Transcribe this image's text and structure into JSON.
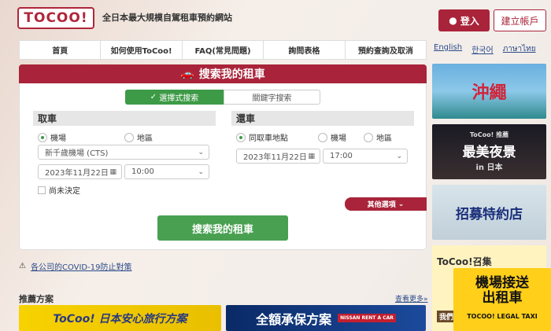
{
  "header": {
    "logo": "TOCOO!",
    "tagline": "全日本最大規模自駕租車預約網站",
    "login": "登入",
    "register": "建立帳戶"
  },
  "nav": [
    "首頁",
    "如何使用ToCoo!",
    "FAQ(常見問題)",
    "詢問表格",
    "預約查詢及取消"
  ],
  "langs": [
    "English",
    "한국어",
    "ภาษาไทย"
  ],
  "search": {
    "title": "搜索我的租車",
    "tab_select": "選擇式搜索",
    "tab_keyword": "關鍵字搜索",
    "pickup": {
      "heading": "取車",
      "opt_airport": "機場",
      "opt_area": "地區",
      "location": "新千歲機場 (CTS)",
      "date": "2023年11月22日",
      "time": "10:00",
      "undecided": "尚未決定"
    },
    "return": {
      "heading": "還車",
      "opt_same": "同取車地點",
      "opt_airport": "機場",
      "opt_area": "地區",
      "date": "2023年11月22日",
      "time": "17:00"
    },
    "other_options": "其他選項",
    "submit": "搜索我的租車"
  },
  "covid": "各公司的COVID-19防止對策",
  "recommend": {
    "title": "推薦方案",
    "see_more": "查看更多»",
    "items": [
      "ToCoo! 日本安心旅行方案",
      "全額承保方案"
    ],
    "brand_badge": "NISSAN RENT A CAR"
  },
  "side_banners": {
    "okinawa": "沖繩",
    "nightview_small": "ToCoo! 推薦",
    "nightview": "最美夜景",
    "nightview_sub": "in 日本",
    "recruit": "招募特約店",
    "tocoo_recruit": "ToCoo!召集",
    "tocoo_recruit_sub": "我們同您",
    "airport": "機場接送",
    "airport2": "出租車",
    "airport_sub": "TOCOO! LEGAL TAXI"
  }
}
